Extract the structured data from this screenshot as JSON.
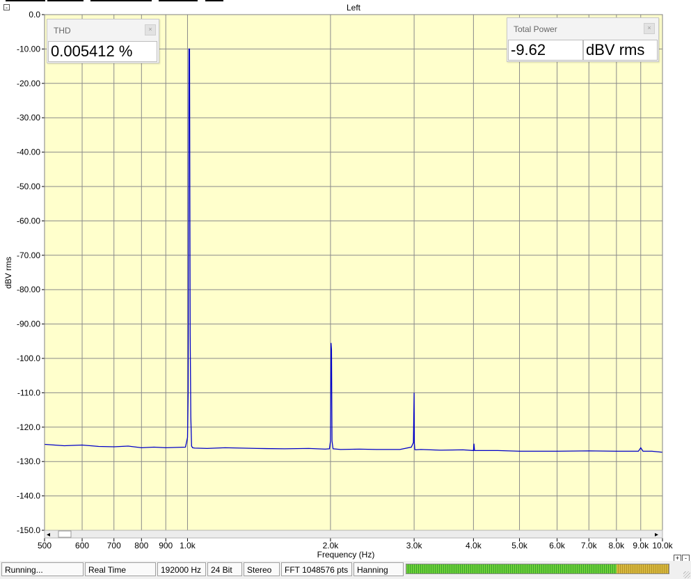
{
  "chart_data": {
    "type": "line",
    "title": "Left",
    "xlabel": "Frequency (Hz)",
    "ylabel": "dBV rms",
    "xscale": "log",
    "xlim": [
      500,
      10000
    ],
    "ylim": [
      -150,
      0
    ],
    "grid": true,
    "x_ticks": [
      500,
      600,
      700,
      800,
      900,
      1000,
      2000,
      3000,
      4000,
      5000,
      6000,
      7000,
      8000,
      9000,
      10000
    ],
    "x_tick_labels": [
      "500",
      "600",
      "700",
      "800",
      "900",
      "1.0k",
      "2.0k",
      "3.0k",
      "4.0k",
      "5.0k",
      "6.0k",
      "7.0k",
      "8.0k",
      "9.0k",
      "10.0k"
    ],
    "y_ticks": [
      0,
      -10,
      -20,
      -30,
      -40,
      -50,
      -60,
      -70,
      -80,
      -90,
      -100,
      -110,
      -120,
      -130,
      -140,
      -150
    ],
    "y_tick_labels": [
      "0.0",
      "-10.00",
      "-20.00",
      "-30.00",
      "-40.00",
      "-50.00",
      "-60.00",
      "-70.00",
      "-80.00",
      "-90.00",
      "-100.0",
      "-110.0",
      "-120.0",
      "-130.0",
      "-140.0",
      "-150.0"
    ],
    "series": [
      {
        "color": "#0000c8",
        "x": [
          500,
          550,
          600,
          650,
          700,
          750,
          800,
          850,
          900,
          950,
          990,
          1000,
          1003,
          1005,
          1007,
          1010,
          1013,
          1016,
          1020,
          1025,
          1035,
          1100,
          1200,
          1400,
          1600,
          1800,
          1950,
          1990,
          2000,
          2005,
          2010,
          2015,
          2025,
          2100,
          2300,
          2500,
          2800,
          2960,
          2990,
          3000,
          3003,
          3010,
          3020,
          3100,
          3400,
          3800,
          4000,
          4010,
          4020,
          4500,
          5000,
          6000,
          7000,
          8000,
          8900,
          9000,
          9100,
          9500,
          10000
        ],
        "y": [
          -125,
          -125.4,
          -125.2,
          -125.6,
          -125.7,
          -125.5,
          -126,
          -125.8,
          -126,
          -125.9,
          -125.8,
          -123,
          -110,
          -70,
          -10,
          -10,
          -93,
          -117,
          -125.5,
          -126,
          -126.1,
          -126.2,
          -126,
          -126.2,
          -126.3,
          -126.2,
          -126.4,
          -126.3,
          -124,
          -95.5,
          -97.5,
          -124,
          -126.3,
          -126.5,
          -126.4,
          -126.5,
          -126.5,
          -125.8,
          -124.5,
          -110,
          -124.5,
          -126.5,
          -126.6,
          -126.5,
          -126.7,
          -126.6,
          -126.8,
          -124.8,
          -126.8,
          -126.8,
          -127,
          -127,
          -126.9,
          -127,
          -127,
          -126,
          -127,
          -127,
          -127.3
        ]
      }
    ]
  },
  "thd_panel": {
    "title": "THD",
    "value": "0.005412 %"
  },
  "power_panel": {
    "title": "Total Power",
    "value": "-9.62",
    "unit": "dBV rms"
  },
  "status": {
    "state": "Running...",
    "mode": "Real Time",
    "sample_rate": "192000 Hz",
    "bit_depth": "24 Bit",
    "channels": "Stereo",
    "fft_size": "FFT 1048576 pts",
    "window": "Hanning"
  },
  "controls": {
    "collapse": "-",
    "scroll_left": "◂",
    "scroll_right": "▸",
    "zoom_in": "+",
    "zoom_out": "-",
    "panel_close": "×"
  }
}
